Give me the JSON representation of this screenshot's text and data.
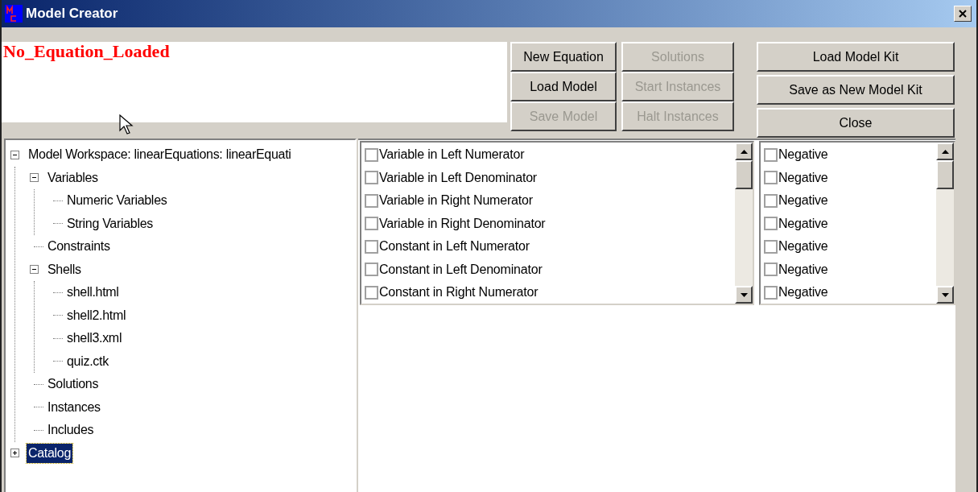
{
  "window": {
    "title": "Model Creator"
  },
  "equation_label": "No_Equation_Loaded",
  "button_columns": [
    [
      {
        "label": "New Equation",
        "disabled": false
      },
      {
        "label": "Load Model",
        "disabled": false
      },
      {
        "label": "Save Model",
        "disabled": true
      }
    ],
    [
      {
        "label": "Solutions",
        "disabled": true
      },
      {
        "label": "Start Instances",
        "disabled": true
      },
      {
        "label": "Halt Instances",
        "disabled": true
      }
    ],
    [
      {
        "label": "Load Model Kit",
        "disabled": false
      },
      {
        "label": "Save as New Model Kit",
        "disabled": false
      },
      {
        "label": "Close",
        "disabled": false
      }
    ]
  ],
  "tree": [
    {
      "label": "Model Workspace: linearEquations: linearEquati",
      "expanded": true,
      "selected": false,
      "children": [
        {
          "label": "Variables",
          "expanded": true,
          "selected": false,
          "children": [
            {
              "label": "Numeric Variables",
              "selected": false
            },
            {
              "label": "String Variables",
              "selected": false
            }
          ]
        },
        {
          "label": "Constraints",
          "selected": false
        },
        {
          "label": "Shells",
          "expanded": true,
          "selected": false,
          "children": [
            {
              "label": "shell.html",
              "selected": false
            },
            {
              "label": "shell2.html",
              "selected": false
            },
            {
              "label": "shell3.xml",
              "selected": false
            },
            {
              "label": "quiz.ctk",
              "selected": false
            }
          ]
        },
        {
          "label": "Solutions",
          "selected": false
        },
        {
          "label": "Instances",
          "selected": false
        },
        {
          "label": "Includes",
          "selected": false
        }
      ]
    },
    {
      "label": "Catalog",
      "expanded": false,
      "selected": true
    }
  ],
  "term_list": [
    {
      "label": "Variable in Left Numerator",
      "checked": false
    },
    {
      "label": "Variable in Left Denominator",
      "checked": false
    },
    {
      "label": "Variable in Right Numerator",
      "checked": false
    },
    {
      "label": "Variable in Right Denominator",
      "checked": false
    },
    {
      "label": "Constant in Left Numerator",
      "checked": false
    },
    {
      "label": "Constant in Left Denominator",
      "checked": false
    },
    {
      "label": "Constant in Right Numerator",
      "checked": false
    }
  ],
  "sign_list": [
    {
      "label": "Negative",
      "checked": false
    },
    {
      "label": "Negative",
      "checked": false
    },
    {
      "label": "Negative",
      "checked": false
    },
    {
      "label": "Negative",
      "checked": false
    },
    {
      "label": "Negative",
      "checked": false
    },
    {
      "label": "Negative",
      "checked": false
    },
    {
      "label": "Negative",
      "checked": false
    }
  ]
}
